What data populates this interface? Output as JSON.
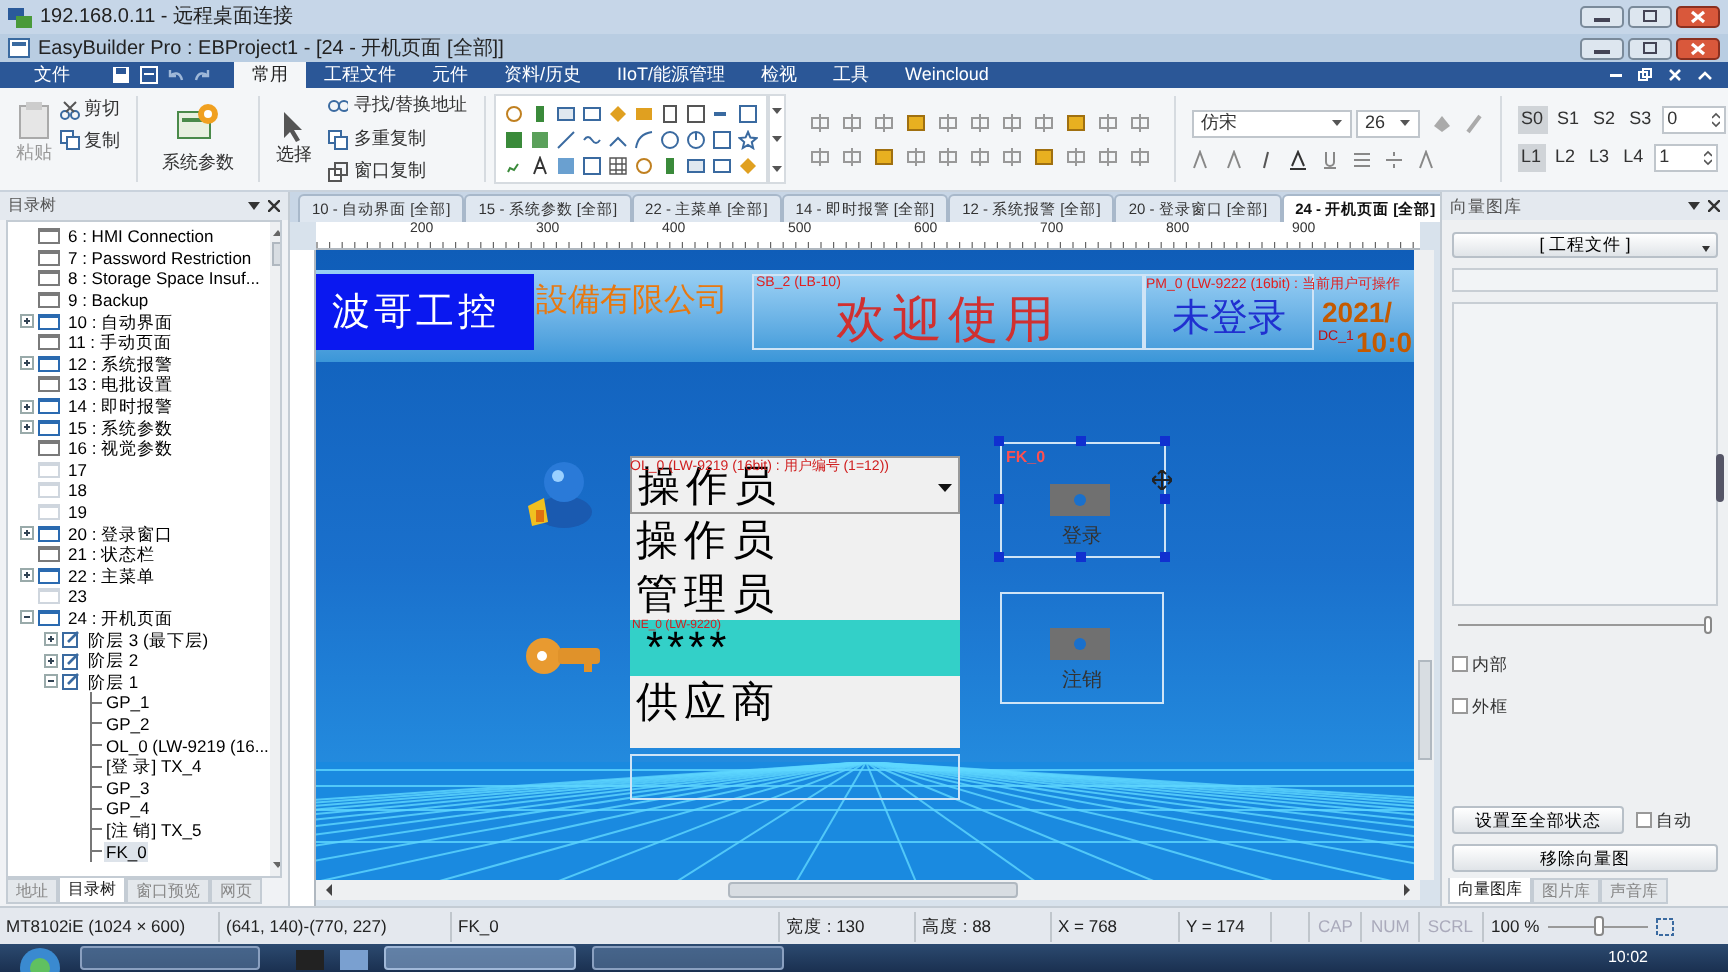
{
  "remote_title": "192.168.0.11 - 远程桌面连接",
  "app_title": "EasyBuilder Pro : EBProject1 - [24 - 开机页面 [全部]]",
  "menu_tabs": [
    {
      "label": "文件",
      "selected": false
    },
    {
      "label": "常用",
      "selected": true
    },
    {
      "label": "工程文件",
      "selected": false
    },
    {
      "label": "元件",
      "selected": false
    },
    {
      "label": "资料/历史",
      "selected": false
    },
    {
      "label": "IIoT/能源管理",
      "selected": false
    },
    {
      "label": "检视",
      "selected": false
    },
    {
      "label": "工具",
      "selected": false
    },
    {
      "label": "Weincloud",
      "selected": false
    }
  ],
  "ribbon": {
    "paste": "粘贴",
    "cut": "剪切",
    "copy": "复制",
    "system_params": "系统参数",
    "select": "选择",
    "find_replace": "寻找/替换地址",
    "multi_copy": "多重复制",
    "window_copy": "窗口复制",
    "font": "仿宋",
    "font_size": "26",
    "states": [
      {
        "label": "S0",
        "selected": true
      },
      {
        "label": "S1",
        "selected": false
      },
      {
        "label": "S2",
        "selected": false
      },
      {
        "label": "S3",
        "selected": false
      }
    ],
    "state_value": "0",
    "levels": [
      {
        "label": "L1",
        "selected": true
      },
      {
        "label": "L2",
        "selected": false
      },
      {
        "label": "L3",
        "selected": false
      },
      {
        "label": "L4",
        "selected": false
      }
    ],
    "level_value": "1"
  },
  "tree": {
    "title": "目录树",
    "items": [
      {
        "label": "6 : HMI Connection",
        "kind": "window",
        "selected": false
      },
      {
        "label": "7 : Password Restriction",
        "kind": "window",
        "selected": false
      },
      {
        "label": "8 : Storage Space Insuf...",
        "kind": "window",
        "selected": false
      },
      {
        "label": "9 : Backup",
        "kind": "window",
        "selected": false
      },
      {
        "label": "10 : 自动界面",
        "kind": "window",
        "expanded": false,
        "selected": false
      },
      {
        "label": "11 : 手动页面",
        "kind": "window",
        "selected": false
      },
      {
        "label": "12 : 系统报警",
        "kind": "window",
        "expanded": false,
        "selected": false
      },
      {
        "label": "13 : 电批设置",
        "kind": "window",
        "selected": false
      },
      {
        "label": "14 : 即时报警",
        "kind": "window",
        "expanded": false,
        "selected": false
      },
      {
        "label": "15 : 系统参数",
        "kind": "window",
        "expanded": false,
        "selected": false
      },
      {
        "label": "16 : 视觉参数",
        "kind": "window",
        "selected": false
      },
      {
        "label": "17",
        "kind": "empty-window",
        "selected": false
      },
      {
        "label": "18",
        "kind": "empty-window",
        "selected": false
      },
      {
        "label": "19",
        "kind": "empty-window",
        "selected": false
      },
      {
        "label": "20 : 登录窗口",
        "kind": "window",
        "expanded": false,
        "selected": false
      },
      {
        "label": "21 : 状态栏",
        "kind": "window",
        "selected": false
      },
      {
        "label": "22 : 主菜单",
        "kind": "window",
        "expanded": false,
        "selected": false
      },
      {
        "label": "23",
        "kind": "empty-window",
        "selected": false
      },
      {
        "label": "24 : 开机页面",
        "kind": "window",
        "expanded": true,
        "selected": false,
        "children": [
          {
            "label": "阶层 3 (最下层)",
            "kind": "layer",
            "expanded": false,
            "selected": false
          },
          {
            "label": "阶层 2",
            "kind": "layer",
            "expanded": false,
            "selected": false
          },
          {
            "label": "阶层 1",
            "kind": "layer",
            "expanded": true,
            "selected": false,
            "children": [
              {
                "label": "GP_1",
                "kind": "object",
                "selected": false
              },
              {
                "label": "GP_2",
                "kind": "object",
                "selected": false
              },
              {
                "label": "OL_0 (LW-9219 (16...",
                "kind": "object",
                "selected": false
              },
              {
                "label": "[登 录] TX_4",
                "kind": "object",
                "selected": false
              },
              {
                "label": "GP_3",
                "kind": "object",
                "selected": false
              },
              {
                "label": "GP_4",
                "kind": "object",
                "selected": false
              },
              {
                "label": "[注 销] TX_5",
                "kind": "object",
                "selected": false
              },
              {
                "label": "FK_0",
                "kind": "object",
                "selected": true
              }
            ]
          }
        ]
      }
    ],
    "tabs": [
      {
        "label": "地址",
        "selected": false
      },
      {
        "label": "目录树",
        "selected": true
      },
      {
        "label": "窗口预览",
        "selected": false
      },
      {
        "label": "网页",
        "selected": false
      }
    ]
  },
  "doc_tabs": [
    {
      "label": "10 - 自动界面 [全部]",
      "selected": false
    },
    {
      "label": "15 - 系统参数 [全部]",
      "selected": false
    },
    {
      "label": "22 - 主菜单 [全部]",
      "selected": false
    },
    {
      "label": "14 - 即时报警 [全部]",
      "selected": false
    },
    {
      "label": "12 - 系统报警 [全部]",
      "selected": false
    },
    {
      "label": "20 - 登录窗口 [全部]",
      "selected": false
    },
    {
      "label": "24 - 开机页面 [全部]",
      "selected": true
    }
  ],
  "ruler": [
    "200",
    "300",
    "400",
    "500",
    "600",
    "700",
    "800",
    "900"
  ],
  "canvas": {
    "brand": "波哥工控",
    "company": "設備有限公司",
    "welcome_label": "SB_2 (LB-10)",
    "welcome": "欢迎使用",
    "user_label": "PM_0 (LW-9222 (16bit) : 当前用户可操作",
    "user": "未登录",
    "date": "2021/",
    "clock_label": "DC_1",
    "time": "10:0",
    "combo": {
      "label": "OL_0 (LW-9219 (16bit) : 用户编号 (1=12))",
      "value": "操作员",
      "options": [
        "操作员",
        "管理员",
        "供应商"
      ]
    },
    "password": {
      "label": "NE_0 (LW-9220)",
      "value": "****"
    },
    "login": {
      "label": "FK_0",
      "text": "登录"
    },
    "logout": {
      "text": "注销"
    }
  },
  "right_panel": {
    "title": "向量图库",
    "dropdown": "[ 工程文件 ]",
    "slider": {
      "level": 1
    },
    "checkboxes": [
      {
        "label": "内部",
        "checked": false
      },
      {
        "label": "外框",
        "checked": false
      }
    ],
    "set_all_button": "设置至全部状态",
    "auto": {
      "label": "自动",
      "checked": false
    },
    "remove_button": "移除向量图",
    "tabs": [
      {
        "label": "向量图库",
        "selected": true
      },
      {
        "label": "图片库",
        "selected": false
      },
      {
        "label": "声音库",
        "selected": false
      }
    ]
  },
  "status_bar": {
    "fields": [
      "MT8102iE (1024 × 600)",
      "(641, 140)-(770, 227)",
      "FK_0",
      "宽度 : 130",
      "高度 : 88",
      "X = 768",
      "Y = 174"
    ],
    "indicators": [
      {
        "label": "CAP",
        "on": false
      },
      {
        "label": "NUM",
        "on": false
      },
      {
        "label": "SCRL",
        "on": false
      }
    ],
    "zoom": "100 %",
    "zoom_slider": {
      "level": 0.5
    }
  },
  "taskbar": {
    "clock": "10:02"
  }
}
